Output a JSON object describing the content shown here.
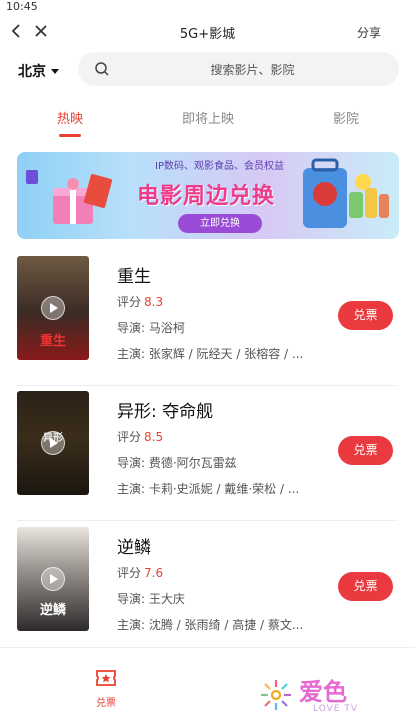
{
  "status_bar": {
    "time": "10:45"
  },
  "navbar": {
    "title": "5G+影城",
    "share_label": "分享"
  },
  "location": {
    "city": "北京"
  },
  "search": {
    "placeholder": "搜索影片、影院"
  },
  "tabs": [
    {
      "label": "热映",
      "active": true
    },
    {
      "label": "即将上映",
      "active": false
    },
    {
      "label": "影院",
      "active": false
    }
  ],
  "banner": {
    "subtitle": "IP数码、观影食品、会员权益",
    "title": "电影周边兑换",
    "button_label": "立即兑换"
  },
  "movies": [
    {
      "title": "重生",
      "score_label": "评分",
      "score": "8.3",
      "director": "导演:  马浴柯",
      "cast": "主演:  张家辉 / 阮经天 / 张榕容 / ...",
      "button": "兑票",
      "poster_text": "重生"
    },
    {
      "title": "异形:  夺命舰",
      "score_label": "评分",
      "score": "8.5",
      "director": "导演:  费德·阿尔瓦雷兹",
      "cast": "主演:  卡莉·史派妮 / 戴维·荣松 / ...",
      "button": "兑票",
      "poster_text": "异形"
    },
    {
      "title": "逆鳞",
      "score_label": "评分",
      "score": "7.6",
      "director": "导演:  王大庆",
      "cast": "主演:  沈腾 / 张雨绮 / 高捷 / 蔡文...",
      "button": "兑票",
      "poster_text": "逆鳞"
    }
  ],
  "bottom_nav": {
    "tab_label": "兑票"
  },
  "watermark": {
    "text": "爱色",
    "sub": "LOVE TV"
  },
  "colors": {
    "accent": "#e8412f",
    "button": "#ea3a3f"
  }
}
